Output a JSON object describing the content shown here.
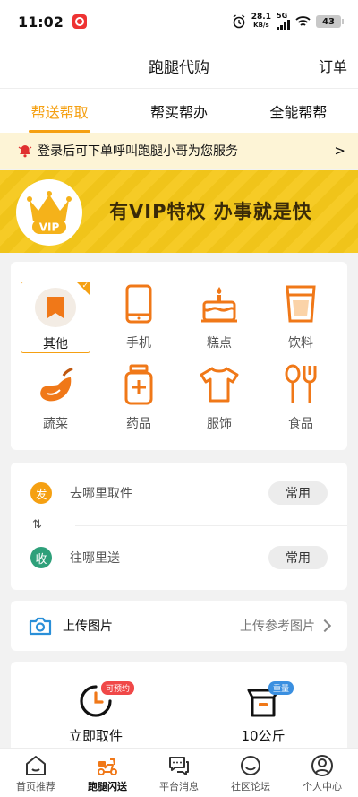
{
  "status_bar": {
    "time": "11:02",
    "net_speed_value": "28.1",
    "net_speed_unit": "KB/s",
    "network_type": "5G",
    "battery": "43"
  },
  "nav": {
    "title": "跑腿代购",
    "right_label": "订单"
  },
  "tabs": [
    {
      "label": "帮送帮取",
      "active": true
    },
    {
      "label": "帮买帮办",
      "active": false
    },
    {
      "label": "全能帮帮",
      "active": false
    }
  ],
  "notice": {
    "text": "登录后可下单呼叫跑腿小哥为您服务",
    "arrow": ">"
  },
  "vip_banner": {
    "badge": "VIP",
    "text": "有VIP特权  办事就是快"
  },
  "categories": [
    {
      "label": "其他",
      "icon": "bookmark-icon",
      "selected": true
    },
    {
      "label": "手机",
      "icon": "phone-icon",
      "selected": false
    },
    {
      "label": "糕点",
      "icon": "cake-icon",
      "selected": false
    },
    {
      "label": "饮料",
      "icon": "drink-cup-icon",
      "selected": false
    },
    {
      "label": "蔬菜",
      "icon": "eggplant-icon",
      "selected": false
    },
    {
      "label": "药品",
      "icon": "medicine-bottle-icon",
      "selected": false
    },
    {
      "label": "服饰",
      "icon": "tshirt-icon",
      "selected": false
    },
    {
      "label": "食品",
      "icon": "utensils-icon",
      "selected": false
    }
  ],
  "address": {
    "pickup": {
      "badge": "发",
      "placeholder": "去哪里取件",
      "button": "常用"
    },
    "delivery": {
      "badge": "收",
      "placeholder": "往哪里送",
      "button": "常用"
    }
  },
  "upload": {
    "label": "上传图片",
    "hint": "上传参考图片"
  },
  "options": [
    {
      "label": "立即取件",
      "badge": "可预约",
      "icon": "clock-icon"
    },
    {
      "label": "10公斤",
      "badge": "重量",
      "icon": "box-icon"
    }
  ],
  "tabbar": [
    {
      "label": "首页推荐",
      "icon": "home-icon",
      "active": false
    },
    {
      "label": "跑腿闪送",
      "icon": "scooter-icon",
      "active": true
    },
    {
      "label": "平台消息",
      "icon": "chat-icon",
      "active": false
    },
    {
      "label": "社区论坛",
      "icon": "smile-icon",
      "active": false
    },
    {
      "label": "个人中心",
      "icon": "user-icon",
      "active": false
    }
  ],
  "colors": {
    "accent": "#f5a012",
    "icon_orange": "#f07818",
    "vip_yellow": "#f5c81a",
    "pickup_badge": "#f5a012",
    "delivery_badge": "#2ea07a"
  }
}
